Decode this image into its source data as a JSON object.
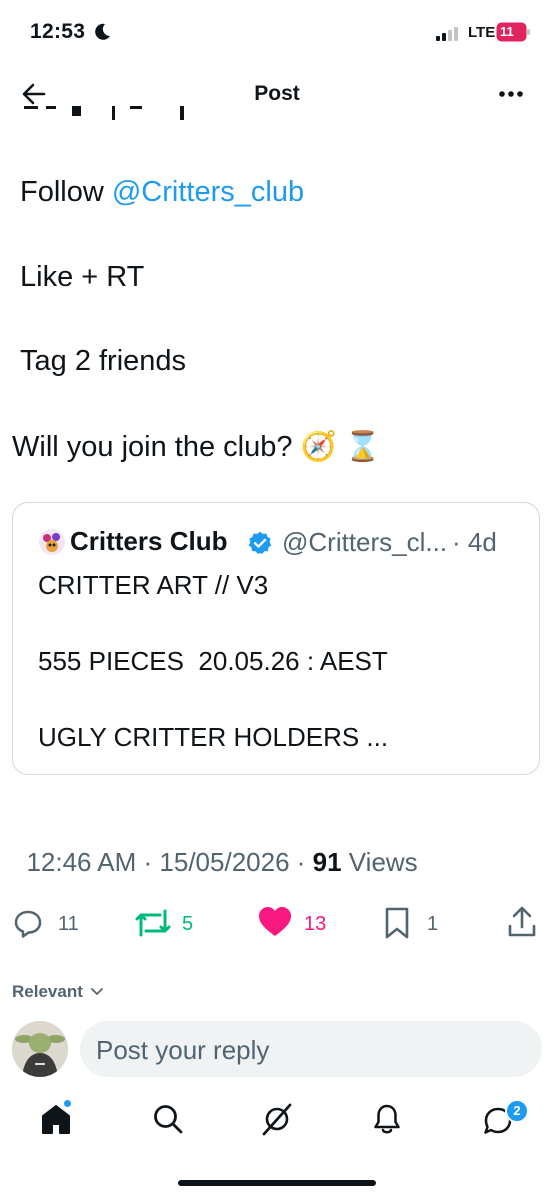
{
  "status": {
    "time": "12:53",
    "network": "LTE",
    "battery": "11"
  },
  "nav": {
    "title": "Post"
  },
  "post": {
    "follow_prefix": "Follow ",
    "follow_handle": "@Critters_club",
    "line2": "Like + RT",
    "line3": "Tag 2 friends",
    "line4": "Will you join the club? 🧭 ⌛"
  },
  "quote": {
    "name": "Critters Club",
    "handle": "@Critters_cl...",
    "time": "· 4d",
    "text1": "CRITTER ART // V3",
    "text2": "555 PIECES  20.05.26 : AEST",
    "text3": "UGLY CRITTER HOLDERS ..."
  },
  "meta": {
    "time": "12:46 AM · 15/05/2026 · ",
    "views_count": "91",
    "views_label": " Views"
  },
  "actions": {
    "replies": "11",
    "reposts": "5",
    "likes": "13",
    "bookmarks": "1"
  },
  "colors": {
    "accent": "#1d9bf0",
    "repost": "#00ba7c",
    "like": "#f91880",
    "text": "#0f1419",
    "secondary": "#536471"
  },
  "replies": {
    "sort": "Relevant"
  },
  "reply_box": {
    "placeholder": "Post your reply"
  },
  "tabbar": {
    "messages_badge": "2"
  }
}
